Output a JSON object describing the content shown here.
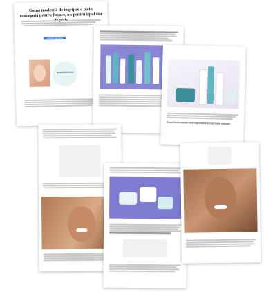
{
  "article": {
    "title": "Gama modernă de îngrijire a pielii concepută pentru fiecare, nu pentru tipul tău de piele",
    "button_label": "Citește mai mult",
    "badge_text": "NUTRICENTIALS",
    "caption_text": "Gama Nutricentials este disponibilă în mai multe variante"
  },
  "colors": {
    "accent": "#3b7bd9",
    "product_bg": "#8a86d4",
    "tube_teal": "#5fb6c2",
    "skin": "#c48a66"
  }
}
